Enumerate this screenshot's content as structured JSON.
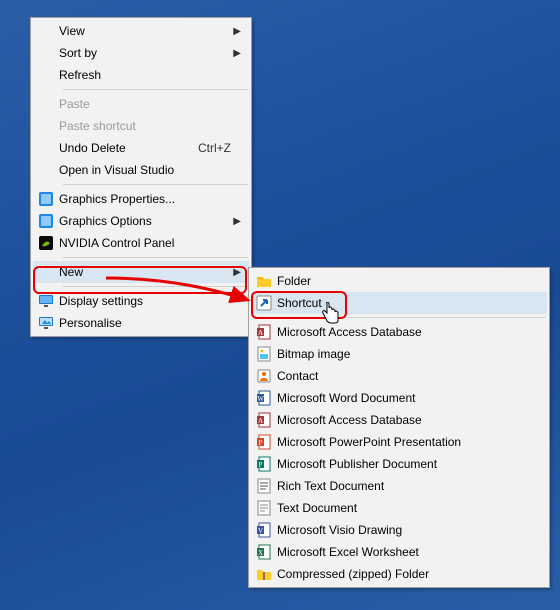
{
  "menu1": {
    "view": "View",
    "sortby": "Sort by",
    "refresh": "Refresh",
    "paste": "Paste",
    "pasteshortcut": "Paste shortcut",
    "undodelete": "Undo Delete",
    "undodelete_sc": "Ctrl+Z",
    "openvs": "Open in Visual Studio",
    "gfxprops": "Graphics Properties...",
    "gfxopts": "Graphics Options",
    "nvidia": "NVIDIA Control Panel",
    "new": "New",
    "display": "Display settings",
    "personalise": "Personalise"
  },
  "menu2": {
    "folder": "Folder",
    "shortcut": "Shortcut",
    "access1": "Microsoft Access Database",
    "bitmap": "Bitmap image",
    "contact": "Contact",
    "word": "Microsoft Word Document",
    "access2": "Microsoft Access Database",
    "ppt": "Microsoft PowerPoint Presentation",
    "pub": "Microsoft Publisher Document",
    "rtf": "Rich Text Document",
    "txt": "Text Document",
    "visio": "Microsoft Visio Drawing",
    "xls": "Microsoft Excel Worksheet",
    "zip": "Compressed (zipped) Folder"
  }
}
